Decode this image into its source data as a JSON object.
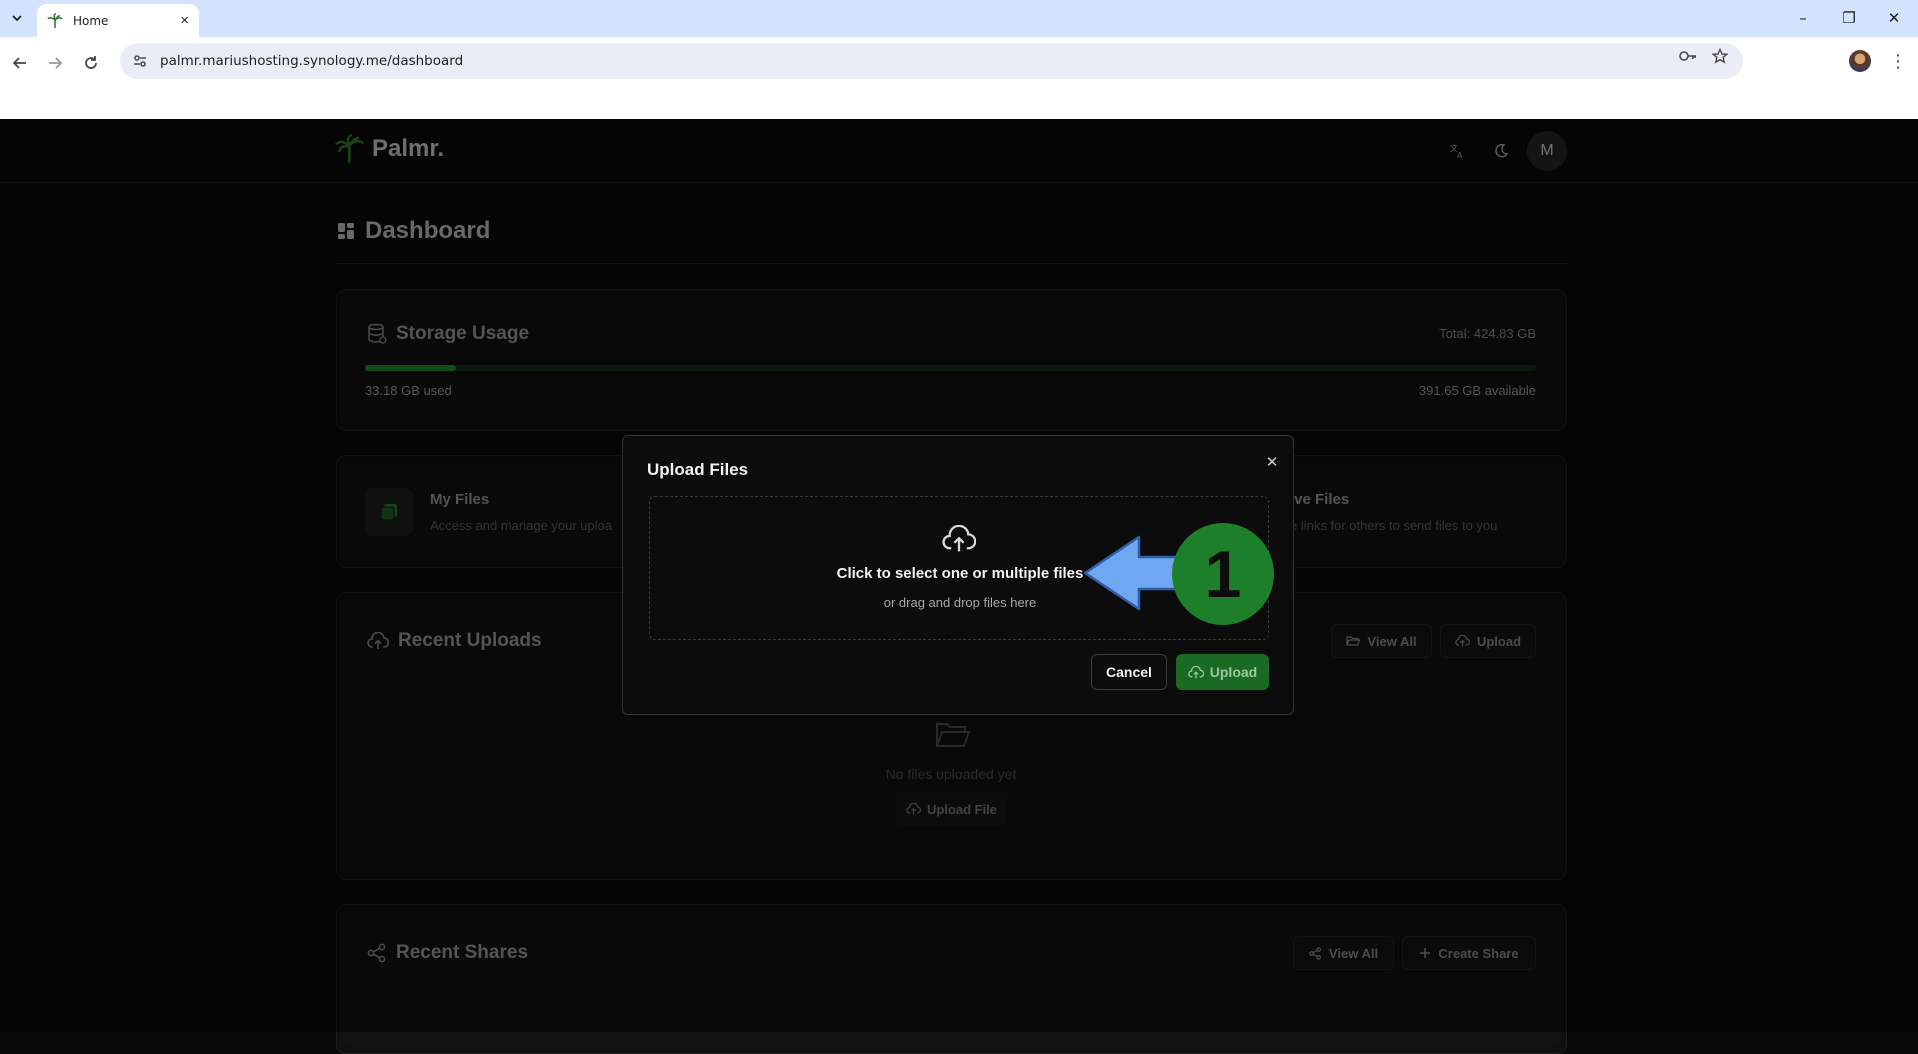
{
  "browser": {
    "tab_title": "Home",
    "tab_close": "×",
    "url": "palmr.mariushosting.synology.me/dashboard",
    "window_controls": {
      "minimize": "–",
      "restore": "❐",
      "close": "✕"
    }
  },
  "app": {
    "logo_text": "Palmr.",
    "avatar_initial": "M",
    "page_title": "Dashboard"
  },
  "storage": {
    "title": "Storage Usage",
    "total": "Total: 424.83 GB",
    "used": "33.18 GB used",
    "available": "391.65 GB available",
    "used_fraction": 0.078
  },
  "quick_actions": {
    "my_files_title": "My Files",
    "my_files_desc": "Access and manage your uploa",
    "receive_title": "ive Files",
    "receive_desc": "e links for others to send files to you"
  },
  "recent_uploads": {
    "title": "Recent Uploads",
    "view_all": "View All",
    "upload": "Upload",
    "empty_text": "No files uploaded yet",
    "upload_file": "Upload File"
  },
  "recent_shares": {
    "title": "Recent Shares",
    "view_all": "View All",
    "create_share": "Create Share"
  },
  "modal": {
    "title": "Upload Files",
    "close": "✕",
    "dropzone_main": "Click to select one or multiple files",
    "dropzone_sub": "or drag and drop files here",
    "cancel": "Cancel",
    "upload": "Upload"
  },
  "annotation": {
    "step_number": "1",
    "badge_color": "#1e7f2a",
    "arrow_color": "#6fa8f0"
  },
  "colors": {
    "accent_green": "#1f8a2b",
    "upload_button": "#1b6a24",
    "background": "#0a0a0a"
  }
}
